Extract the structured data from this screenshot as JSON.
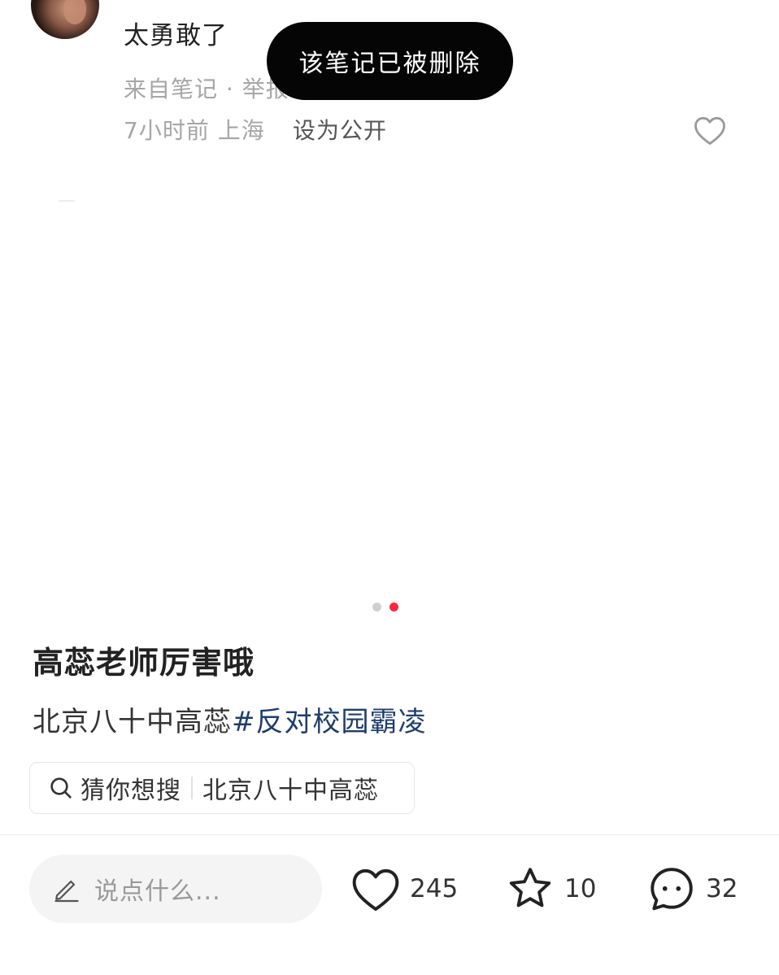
{
  "comment": {
    "text": "太勇敢了",
    "source": "来自笔记 · 举报",
    "time_location": "7小时前  上海",
    "set_public": "设为公开"
  },
  "toast": {
    "message": "该笔记已被删除"
  },
  "carousel": {
    "total": 2,
    "active_index": 2,
    "active_color": "#ff2442"
  },
  "note": {
    "title": "高蕊老师厉害哦",
    "body_text": "北京八十中高蕊",
    "hashtag": "#反对校园霸凌",
    "hashtag_color": "#1f3d6e"
  },
  "search_suggest": {
    "icon": "search-icon",
    "label": "猜你想搜",
    "query": "北京八十中高蕊"
  },
  "bottom_bar": {
    "input_placeholder": "说点什么...",
    "input_icon": "pencil-icon",
    "likes": "245",
    "collects": "10",
    "comments": "32"
  }
}
